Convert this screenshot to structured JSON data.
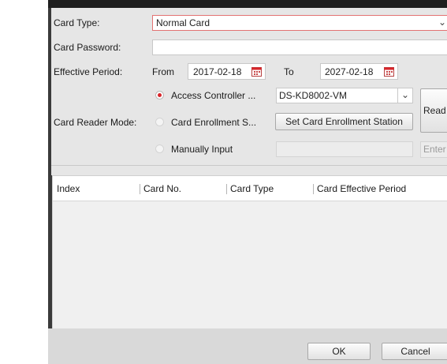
{
  "form": {
    "card_type_label": "Card Type:",
    "card_type_value": "Normal Card",
    "card_password_label": "Card Password:",
    "card_password_value": "",
    "effective_period_label": "Effective Period:",
    "from_label": "From",
    "from_date": "2017-02-18",
    "to_label": "To",
    "to_date": "2027-02-18",
    "card_reader_mode_label": "Card Reader Mode:",
    "mode_access_controller": "Access Controller ...",
    "mode_access_controller_selected": true,
    "mode_card_enrollment": "Card Enrollment S...",
    "mode_manual": "Manually Input",
    "device_value": "DS-KD8002-VM",
    "set_enrollment_button": "Set Card Enrollment Station",
    "read_button": "Read",
    "enter_button": "Enter",
    "manual_input_value": ""
  },
  "table": {
    "columns": [
      "Index",
      "Card No.",
      "Card Type",
      "Card Effective Period"
    ],
    "rows": []
  },
  "footer": {
    "ok_label": "OK",
    "cancel_label": "Cancel"
  },
  "colors": {
    "accent_red": "#d8262b",
    "dialog_frame": "#3a3a3a",
    "form_background": "#e6e6e6"
  }
}
